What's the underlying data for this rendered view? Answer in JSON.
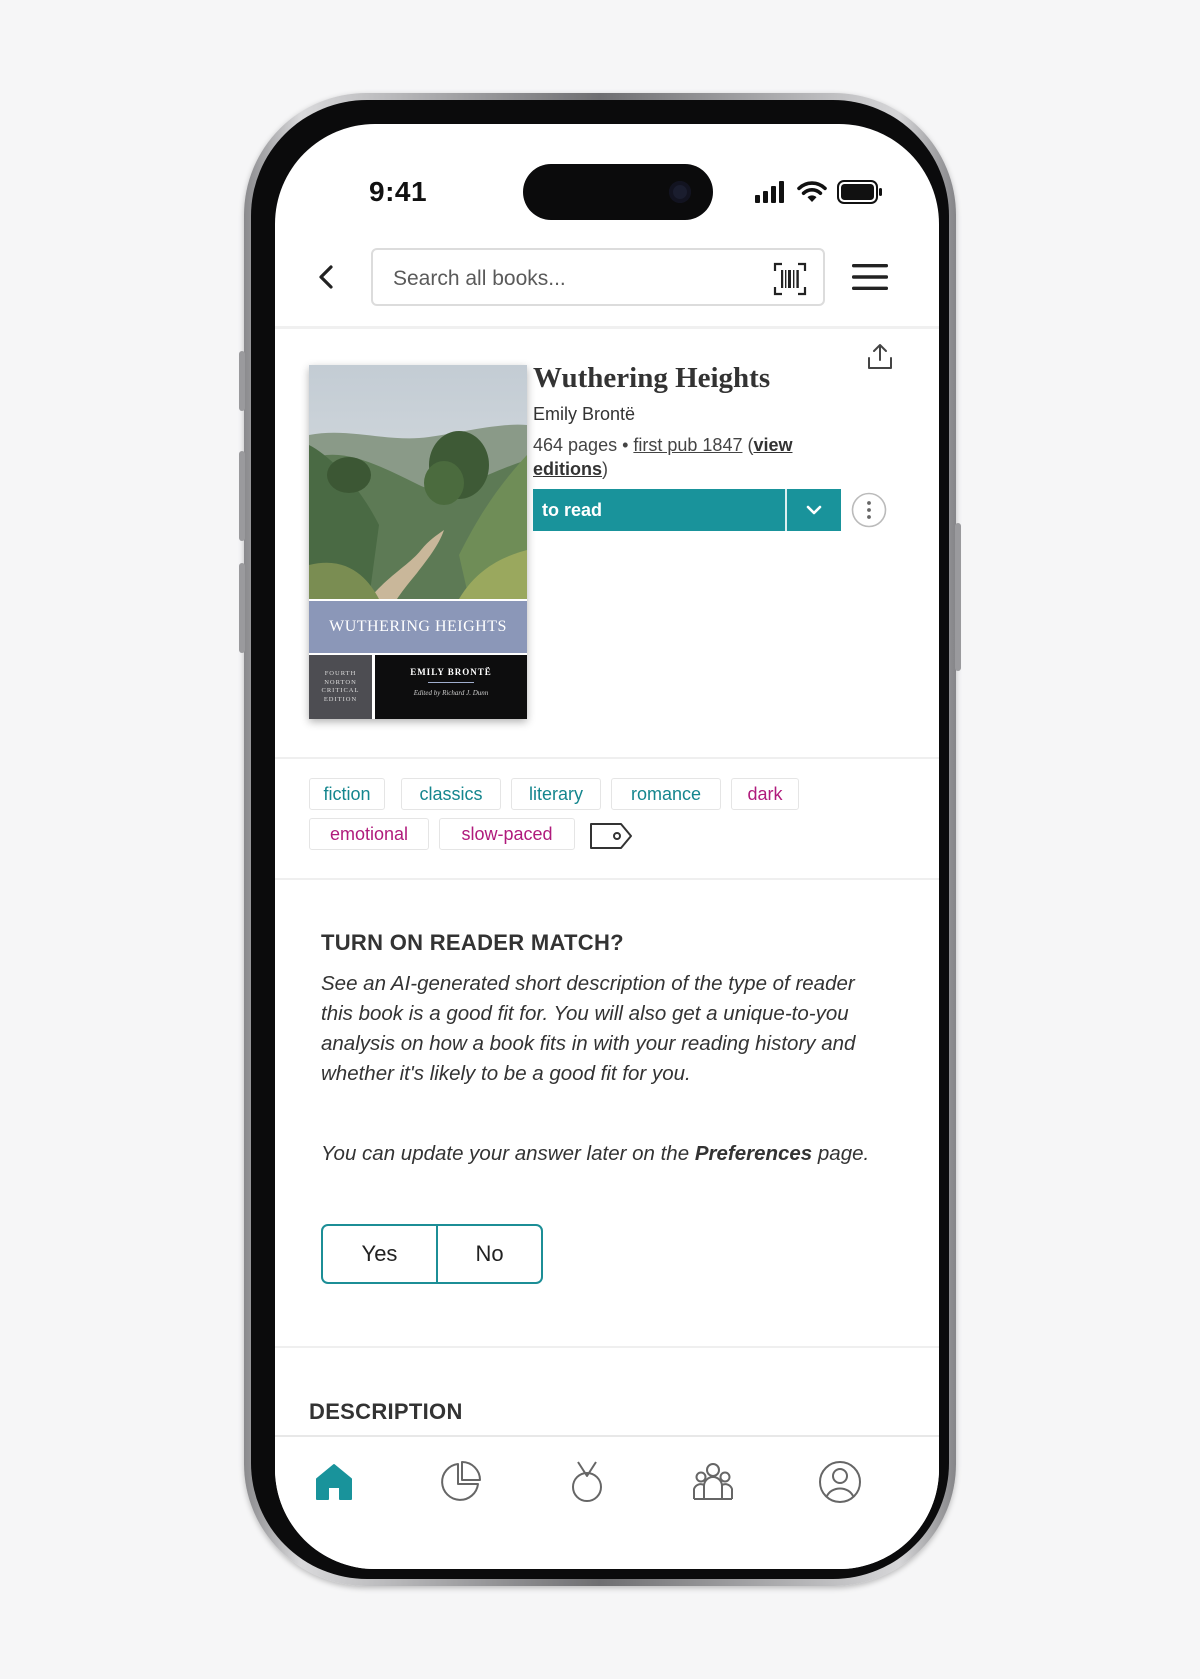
{
  "status_bar": {
    "time": "9:41"
  },
  "search": {
    "placeholder": "Search all books..."
  },
  "book": {
    "title": "Wuthering Heights",
    "author": "Emily Brontë",
    "pages": "464 pages",
    "separator": " • ",
    "first_pub": "first pub 1847",
    "paren_open": " (",
    "view_editions": "view editions",
    "paren_close": ")",
    "shelf_label": "to read",
    "cover": {
      "title": "WUTHERING HEIGHTS",
      "series_lines": [
        "FOURTH",
        "NORTON",
        "CRITICAL",
        "EDITION"
      ],
      "author": "EMILY BRONTË",
      "editor": "Edited by Richard J. Dunn"
    }
  },
  "tags": [
    {
      "label": "fiction",
      "color": "teal"
    },
    {
      "label": "classics",
      "color": "teal"
    },
    {
      "label": "literary",
      "color": "teal"
    },
    {
      "label": "romance",
      "color": "teal"
    },
    {
      "label": "dark",
      "color": "pink"
    },
    {
      "label": "emotional",
      "color": "pink"
    },
    {
      "label": "slow-paced",
      "color": "pink"
    }
  ],
  "reader_match": {
    "title": "TURN ON READER MATCH?",
    "body": "See an AI-generated short description of the type of reader this book is a good fit for. You will also get a unique-to-you analysis on how a book fits in with your reading history and whether it's likely to be a good fit for you.",
    "note_prefix": "You can update your answer later on the ",
    "note_bold": "Preferences",
    "note_suffix": " page.",
    "yes_label": "Yes",
    "no_label": "No"
  },
  "description": {
    "heading": "DESCRIPTION"
  },
  "nav": [
    "home-icon",
    "stats-icon",
    "challenges-icon",
    "community-icon",
    "profile-icon"
  ],
  "colors": {
    "accent": "#19939b",
    "tag_teal": "#15868e",
    "tag_pink": "#b01b7c"
  }
}
